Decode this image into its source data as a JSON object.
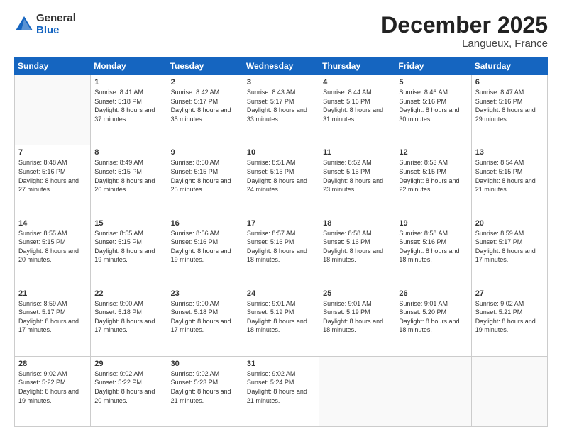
{
  "header": {
    "logo": {
      "general": "General",
      "blue": "Blue"
    },
    "title": "December 2025",
    "location": "Langueux, France"
  },
  "calendar": {
    "days_of_week": [
      "Sunday",
      "Monday",
      "Tuesday",
      "Wednesday",
      "Thursday",
      "Friday",
      "Saturday"
    ],
    "weeks": [
      [
        {
          "day": "",
          "sunrise": "",
          "sunset": "",
          "daylight": "",
          "empty": true
        },
        {
          "day": "1",
          "sunrise": "Sunrise: 8:41 AM",
          "sunset": "Sunset: 5:18 PM",
          "daylight": "Daylight: 8 hours and 37 minutes."
        },
        {
          "day": "2",
          "sunrise": "Sunrise: 8:42 AM",
          "sunset": "Sunset: 5:17 PM",
          "daylight": "Daylight: 8 hours and 35 minutes."
        },
        {
          "day": "3",
          "sunrise": "Sunrise: 8:43 AM",
          "sunset": "Sunset: 5:17 PM",
          "daylight": "Daylight: 8 hours and 33 minutes."
        },
        {
          "day": "4",
          "sunrise": "Sunrise: 8:44 AM",
          "sunset": "Sunset: 5:16 PM",
          "daylight": "Daylight: 8 hours and 31 minutes."
        },
        {
          "day": "5",
          "sunrise": "Sunrise: 8:46 AM",
          "sunset": "Sunset: 5:16 PM",
          "daylight": "Daylight: 8 hours and 30 minutes."
        },
        {
          "day": "6",
          "sunrise": "Sunrise: 8:47 AM",
          "sunset": "Sunset: 5:16 PM",
          "daylight": "Daylight: 8 hours and 29 minutes."
        }
      ],
      [
        {
          "day": "7",
          "sunrise": "Sunrise: 8:48 AM",
          "sunset": "Sunset: 5:16 PM",
          "daylight": "Daylight: 8 hours and 27 minutes."
        },
        {
          "day": "8",
          "sunrise": "Sunrise: 8:49 AM",
          "sunset": "Sunset: 5:15 PM",
          "daylight": "Daylight: 8 hours and 26 minutes."
        },
        {
          "day": "9",
          "sunrise": "Sunrise: 8:50 AM",
          "sunset": "Sunset: 5:15 PM",
          "daylight": "Daylight: 8 hours and 25 minutes."
        },
        {
          "day": "10",
          "sunrise": "Sunrise: 8:51 AM",
          "sunset": "Sunset: 5:15 PM",
          "daylight": "Daylight: 8 hours and 24 minutes."
        },
        {
          "day": "11",
          "sunrise": "Sunrise: 8:52 AM",
          "sunset": "Sunset: 5:15 PM",
          "daylight": "Daylight: 8 hours and 23 minutes."
        },
        {
          "day": "12",
          "sunrise": "Sunrise: 8:53 AM",
          "sunset": "Sunset: 5:15 PM",
          "daylight": "Daylight: 8 hours and 22 minutes."
        },
        {
          "day": "13",
          "sunrise": "Sunrise: 8:54 AM",
          "sunset": "Sunset: 5:15 PM",
          "daylight": "Daylight: 8 hours and 21 minutes."
        }
      ],
      [
        {
          "day": "14",
          "sunrise": "Sunrise: 8:55 AM",
          "sunset": "Sunset: 5:15 PM",
          "daylight": "Daylight: 8 hours and 20 minutes."
        },
        {
          "day": "15",
          "sunrise": "Sunrise: 8:55 AM",
          "sunset": "Sunset: 5:15 PM",
          "daylight": "Daylight: 8 hours and 19 minutes."
        },
        {
          "day": "16",
          "sunrise": "Sunrise: 8:56 AM",
          "sunset": "Sunset: 5:16 PM",
          "daylight": "Daylight: 8 hours and 19 minutes."
        },
        {
          "day": "17",
          "sunrise": "Sunrise: 8:57 AM",
          "sunset": "Sunset: 5:16 PM",
          "daylight": "Daylight: 8 hours and 18 minutes."
        },
        {
          "day": "18",
          "sunrise": "Sunrise: 8:58 AM",
          "sunset": "Sunset: 5:16 PM",
          "daylight": "Daylight: 8 hours and 18 minutes."
        },
        {
          "day": "19",
          "sunrise": "Sunrise: 8:58 AM",
          "sunset": "Sunset: 5:16 PM",
          "daylight": "Daylight: 8 hours and 18 minutes."
        },
        {
          "day": "20",
          "sunrise": "Sunrise: 8:59 AM",
          "sunset": "Sunset: 5:17 PM",
          "daylight": "Daylight: 8 hours and 17 minutes."
        }
      ],
      [
        {
          "day": "21",
          "sunrise": "Sunrise: 8:59 AM",
          "sunset": "Sunset: 5:17 PM",
          "daylight": "Daylight: 8 hours and 17 minutes."
        },
        {
          "day": "22",
          "sunrise": "Sunrise: 9:00 AM",
          "sunset": "Sunset: 5:18 PM",
          "daylight": "Daylight: 8 hours and 17 minutes."
        },
        {
          "day": "23",
          "sunrise": "Sunrise: 9:00 AM",
          "sunset": "Sunset: 5:18 PM",
          "daylight": "Daylight: 8 hours and 17 minutes."
        },
        {
          "day": "24",
          "sunrise": "Sunrise: 9:01 AM",
          "sunset": "Sunset: 5:19 PM",
          "daylight": "Daylight: 8 hours and 18 minutes."
        },
        {
          "day": "25",
          "sunrise": "Sunrise: 9:01 AM",
          "sunset": "Sunset: 5:19 PM",
          "daylight": "Daylight: 8 hours and 18 minutes."
        },
        {
          "day": "26",
          "sunrise": "Sunrise: 9:01 AM",
          "sunset": "Sunset: 5:20 PM",
          "daylight": "Daylight: 8 hours and 18 minutes."
        },
        {
          "day": "27",
          "sunrise": "Sunrise: 9:02 AM",
          "sunset": "Sunset: 5:21 PM",
          "daylight": "Daylight: 8 hours and 19 minutes."
        }
      ],
      [
        {
          "day": "28",
          "sunrise": "Sunrise: 9:02 AM",
          "sunset": "Sunset: 5:22 PM",
          "daylight": "Daylight: 8 hours and 19 minutes."
        },
        {
          "day": "29",
          "sunrise": "Sunrise: 9:02 AM",
          "sunset": "Sunset: 5:22 PM",
          "daylight": "Daylight: 8 hours and 20 minutes."
        },
        {
          "day": "30",
          "sunrise": "Sunrise: 9:02 AM",
          "sunset": "Sunset: 5:23 PM",
          "daylight": "Daylight: 8 hours and 21 minutes."
        },
        {
          "day": "31",
          "sunrise": "Sunrise: 9:02 AM",
          "sunset": "Sunset: 5:24 PM",
          "daylight": "Daylight: 8 hours and 21 minutes."
        },
        {
          "day": "",
          "sunrise": "",
          "sunset": "",
          "daylight": "",
          "empty": true
        },
        {
          "day": "",
          "sunrise": "",
          "sunset": "",
          "daylight": "",
          "empty": true
        },
        {
          "day": "",
          "sunrise": "",
          "sunset": "",
          "daylight": "",
          "empty": true
        }
      ]
    ]
  }
}
